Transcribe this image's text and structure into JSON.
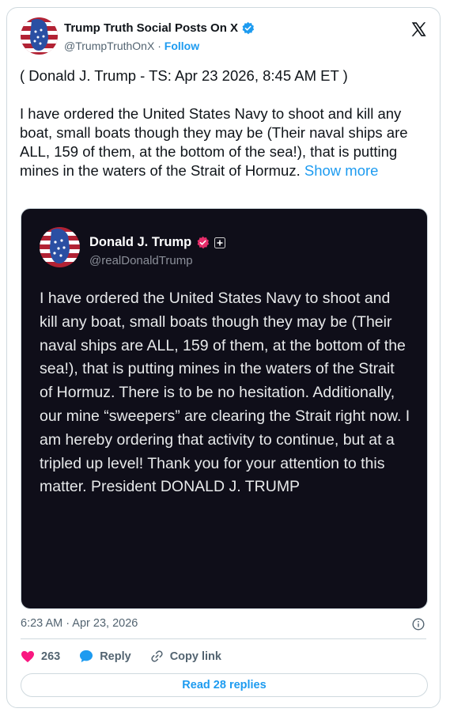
{
  "header": {
    "name": "Trump Truth Social Posts On X",
    "handle": "@TrumpTruthOnX",
    "separator": " · ",
    "follow_label": "Follow"
  },
  "post": {
    "intro": "( Donald J. Trump - TS: Apr 23 2026, 8:45 AM ET )",
    "text": "I have ordered the United States Navy to shoot and kill any boat, small boats though they may be (Their naval ships are ALL, 159 of them, at the bottom of the sea!), that is putting mines in the waters of the Strait of Hormuz.",
    "show_more": "Show more"
  },
  "quote": {
    "name": "Donald J. Trump",
    "handle": "@realDonaldTrump",
    "text": "I have ordered the United States Navy to shoot and kill any boat, small boats though they may be (Their naval ships are ALL, 159 of them, at the bottom of the sea!), that is putting mines in the waters of the Strait of Hormuz. There is to be no hesitation. Additionally, our mine “sweepers” are clearing the Strait right now. I am hereby ordering that activity to continue, but at a tripled up level! Thank you for your attention to this matter. President DONALD J. TRUMP"
  },
  "meta": {
    "timestamp": "6:23 AM · Apr 23, 2026"
  },
  "actions": {
    "like_count": "263",
    "reply_label": "Reply",
    "copy_label": "Copy link"
  },
  "footer": {
    "read_replies": "Read 28 replies"
  },
  "colors": {
    "accent": "#1d9bf0",
    "like": "#f91880",
    "quote_bg": "#0f0e19",
    "truth_badge": "#e62d6a"
  },
  "icons": [
    "verified-badge-icon",
    "x-logo-icon",
    "plus-box-icon",
    "info-icon",
    "heart-icon",
    "reply-bubble-icon",
    "link-icon"
  ]
}
